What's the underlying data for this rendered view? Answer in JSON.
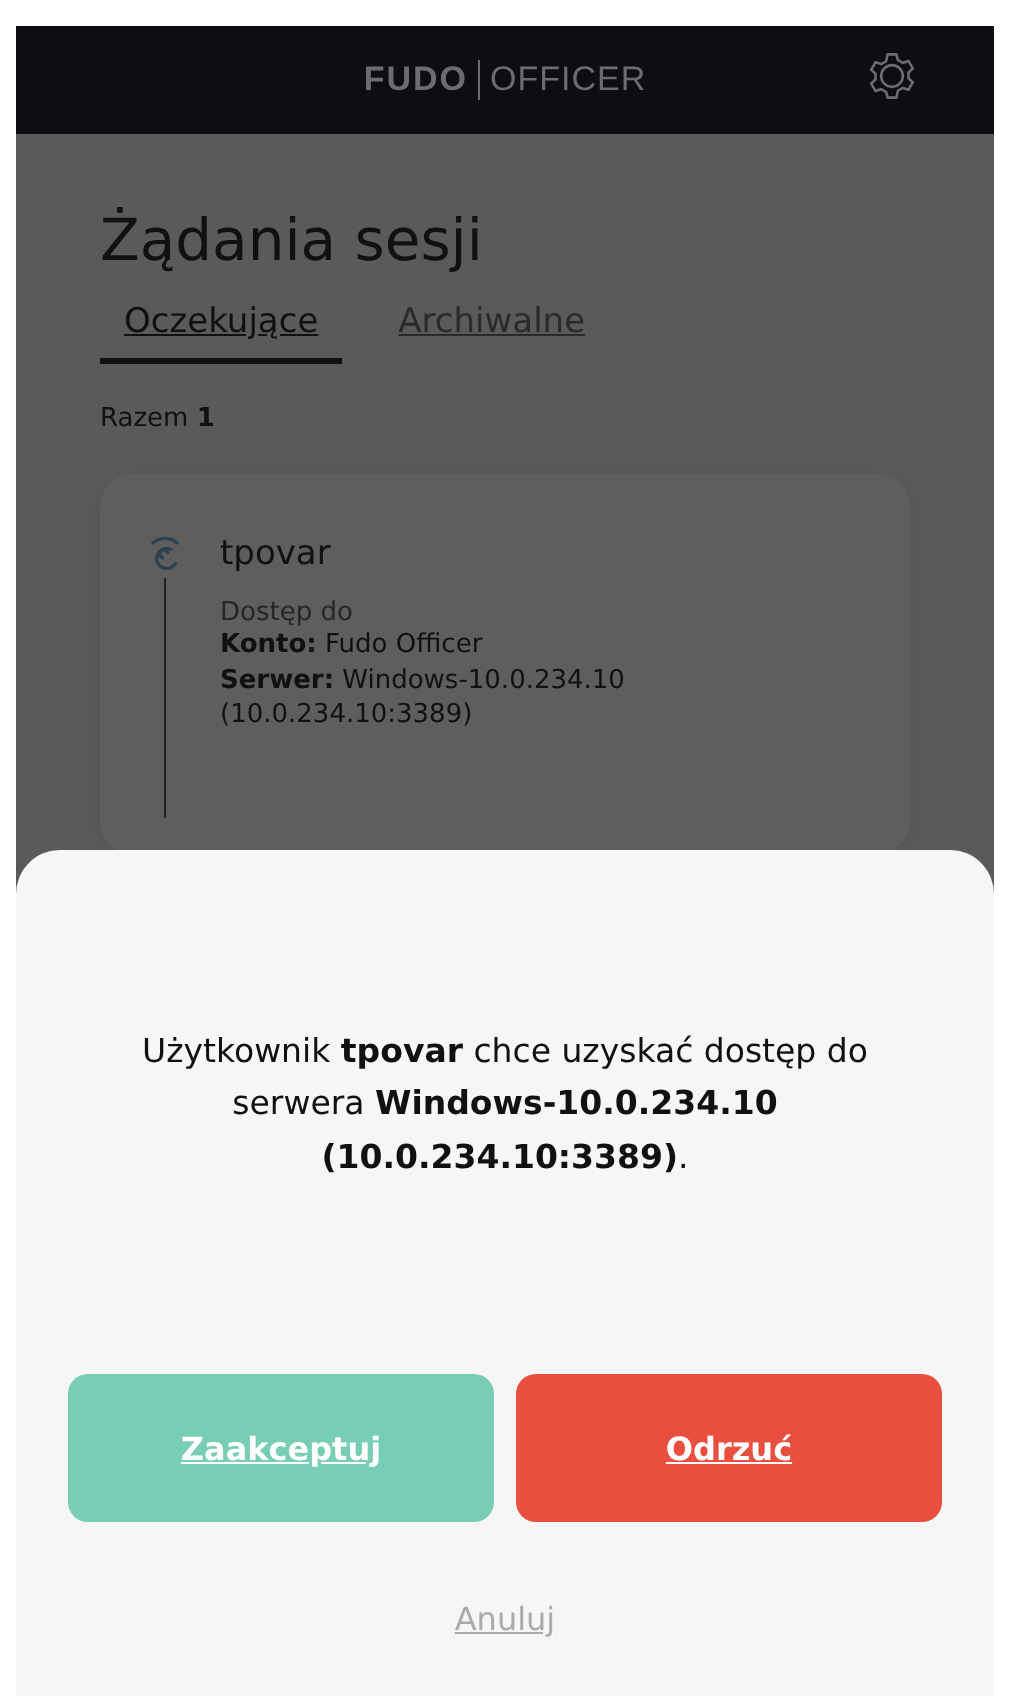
{
  "header": {
    "logo_primary": "FUDO",
    "logo_secondary": "OFFICER"
  },
  "title": "Żądania sesji",
  "tabs": [
    {
      "label": "Oczekujące",
      "selected": true
    },
    {
      "label": "Archiwalne",
      "selected": false
    }
  ],
  "total": {
    "label": "Razem",
    "count": "1"
  },
  "requests": [
    {
      "user": "tpovar",
      "access_label": "Dostęp do",
      "account_label": "Konto:",
      "account": "Fudo Officer",
      "server_label": "Serwer:",
      "server": "Windows-10.0.234.10",
      "address": "(10.0.234.10:3389)"
    }
  ],
  "dialog": {
    "message": "Użytkownik **tpovar** chce uzyskać dostęp do serwera **Windows-10.0.234.10 (10.0.234.10:3389)**.",
    "buttons": [
      {
        "label": "Zaakceptuj",
        "kind": "accept"
      },
      {
        "label": "Odrzuć",
        "kind": "reject"
      }
    ],
    "cancel": "Anuluj"
  }
}
